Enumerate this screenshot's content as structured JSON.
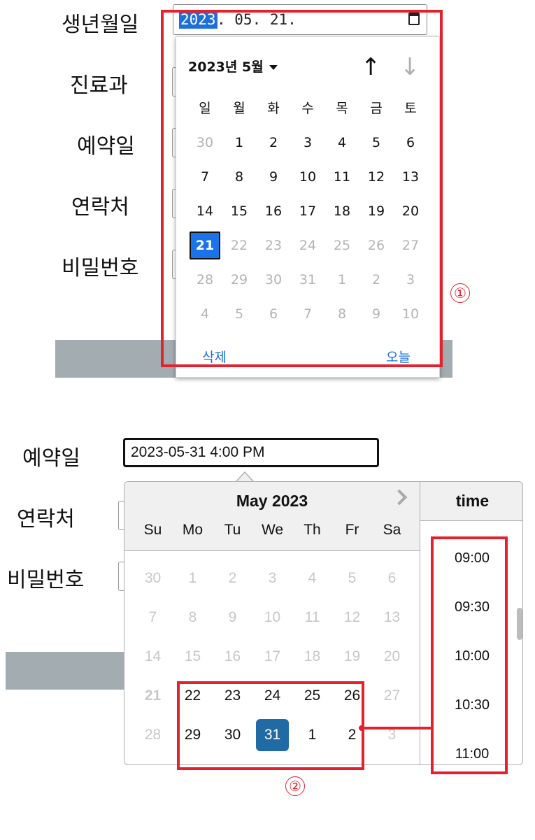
{
  "top_form": {
    "labels": {
      "birthdate": "생년월일",
      "department": "진료과",
      "reservation_date": "예약일",
      "contact": "연락처",
      "password": "비밀번호"
    },
    "date_input": {
      "year_selected": "2023",
      "rest": ". 05. 21."
    },
    "calendar": {
      "header": "2023년 5월",
      "weekdays": [
        "일",
        "월",
        "화",
        "수",
        "목",
        "금",
        "토"
      ],
      "weeks": [
        [
          "30",
          "1",
          "2",
          "3",
          "4",
          "5",
          "6"
        ],
        [
          "7",
          "8",
          "9",
          "10",
          "11",
          "12",
          "13"
        ],
        [
          "14",
          "15",
          "16",
          "17",
          "18",
          "19",
          "20"
        ],
        [
          "21",
          "22",
          "23",
          "24",
          "25",
          "26",
          "27"
        ],
        [
          "28",
          "29",
          "30",
          "31",
          "1",
          "2",
          "3"
        ],
        [
          "4",
          "5",
          "6",
          "7",
          "8",
          "9",
          "10"
        ]
      ],
      "selected": "21",
      "clear_label": "삭제",
      "today_label": "오늘"
    },
    "annotation": "①"
  },
  "bottom_form": {
    "labels": {
      "reservation_date": "예약일",
      "contact": "연락처",
      "password": "비밀번호"
    },
    "datetime_value": "2023-05-31 4:00 PM",
    "calendar": {
      "title": "May 2023",
      "weekdays": [
        "Su",
        "Mo",
        "Tu",
        "We",
        "Th",
        "Fr",
        "Sa"
      ],
      "weeks": [
        [
          "30",
          "1",
          "2",
          "3",
          "4",
          "5",
          "6"
        ],
        [
          "7",
          "8",
          "9",
          "10",
          "11",
          "12",
          "13"
        ],
        [
          "14",
          "15",
          "16",
          "17",
          "18",
          "19",
          "20"
        ],
        [
          "21",
          "22",
          "23",
          "24",
          "25",
          "26",
          "27"
        ],
        [
          "28",
          "29",
          "30",
          "31",
          "1",
          "2",
          "3"
        ]
      ],
      "selected": "31"
    },
    "time": {
      "header": "time",
      "options": [
        "09:00",
        "09:30",
        "10:00",
        "10:30",
        "11:00"
      ]
    },
    "annotation": "②"
  },
  "colors": {
    "accent_blue": "#1a73e8",
    "selected_blue": "#216ba5",
    "annotation_red": "#e2232f",
    "bar_grey": "#a3acb0"
  }
}
